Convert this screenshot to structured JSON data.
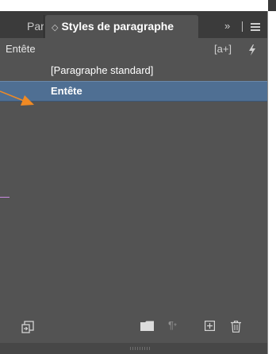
{
  "colors": {
    "panel_bg": "#535353",
    "tabbar_bg": "#3b3b3b",
    "selection_bg": "#4f6f93",
    "annotation_arrow": "#f08a24"
  },
  "tabs": {
    "inactive_label": "Par",
    "active_label": "Styles de paragraphe"
  },
  "header": {
    "title": "Entête",
    "quick_apply_icon_text": "[a+]"
  },
  "styles": [
    {
      "label": "[Paragraphe standard]",
      "selected": false
    },
    {
      "label": "Entête",
      "selected": true
    }
  ],
  "icons": {
    "tab_chevron": "◇",
    "expand": "»",
    "menu": "hamburger-menu-icon",
    "bolt": "lightning-bolt-icon",
    "load": "load-styles-icon",
    "folder": "folder-icon",
    "pilcrow": "¶",
    "new": "new-style-icon",
    "trash": "trash-icon"
  }
}
